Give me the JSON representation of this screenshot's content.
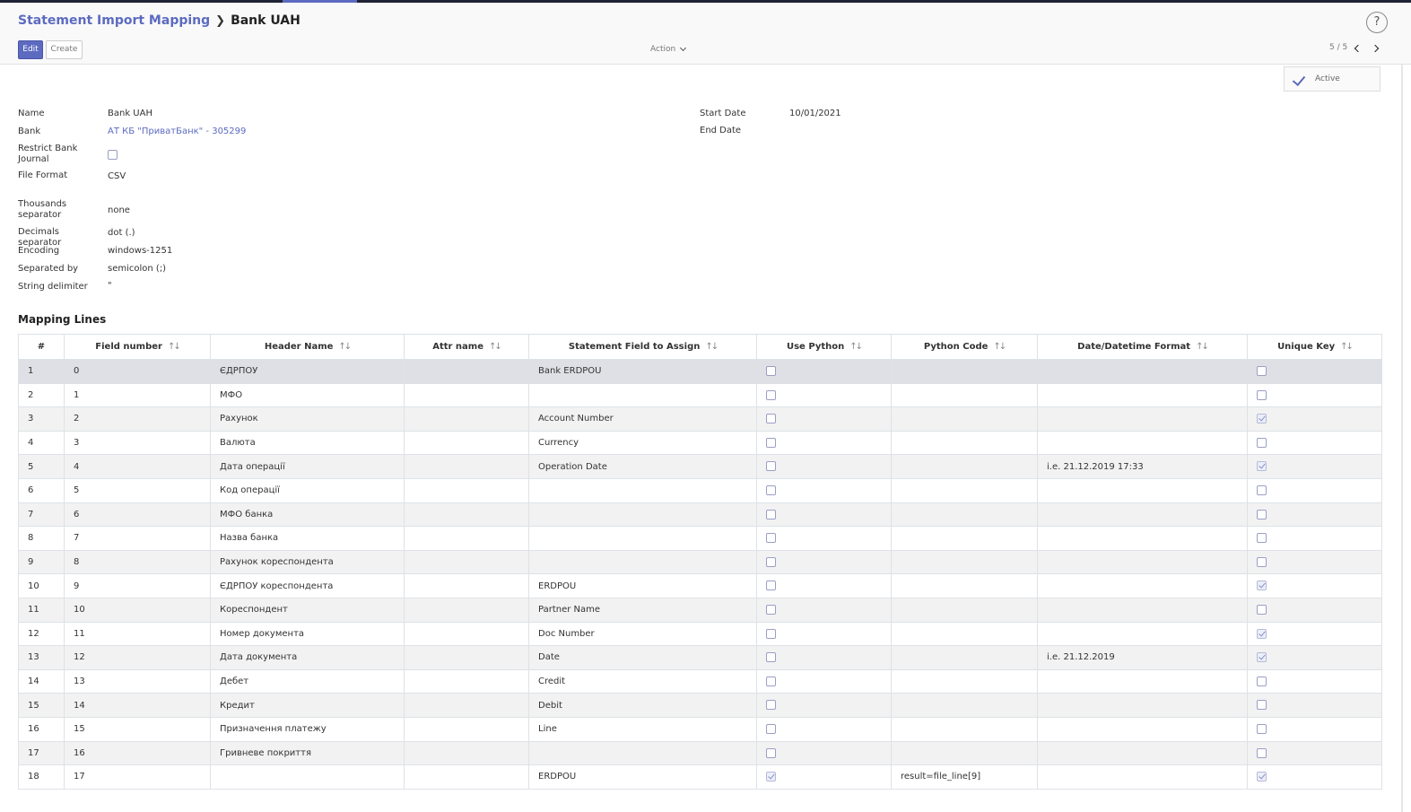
{
  "breadcrumb": {
    "parent": "Statement Import Mapping",
    "current": "Bank UAH"
  },
  "toolbar": {
    "edit_label": "Edit",
    "create_label": "Create",
    "action_label": "Action",
    "pager": "5 / 5",
    "help": "?"
  },
  "status": {
    "active_label": "Active"
  },
  "form": {
    "name_label": "Name",
    "name": "Bank UAH",
    "bank_label": "Bank",
    "bank": "АТ КБ \"ПриватБанк\" - 305299",
    "restrict_label": "Restrict Bank Journal",
    "restrict_checked": false,
    "file_format_label": "File Format",
    "file_format": "CSV",
    "thousands_label": "Thousands separator",
    "thousands": "none",
    "decimals_label": "Decimals separator",
    "decimals": "dot (.)",
    "encoding_label": "Encoding",
    "encoding": "windows-1251",
    "separated_label": "Separated by",
    "separated": "semicolon (;)",
    "delimiter_label": "String delimiter",
    "delimiter": "\"",
    "start_date_label": "Start Date",
    "start_date": "10/01/2021",
    "end_date_label": "End Date",
    "end_date": ""
  },
  "mapping": {
    "title": "Mapping Lines",
    "columns": [
      "#",
      "Field number",
      "Header Name",
      "Attr name",
      "Statement Field to Assign",
      "Use Python",
      "Python Code",
      "Date/Datetime Format",
      "Unique Key"
    ],
    "sortable": [
      false,
      true,
      true,
      true,
      true,
      true,
      true,
      true,
      true
    ],
    "rows": [
      {
        "n": "1",
        "field": "0",
        "header": "ЄДРПОУ",
        "attr": "",
        "assign": "Bank ERDPOU",
        "python": false,
        "code": "",
        "fmt": "",
        "unique": false
      },
      {
        "n": "2",
        "field": "1",
        "header": "МФО",
        "attr": "",
        "assign": "",
        "python": false,
        "code": "",
        "fmt": "",
        "unique": false
      },
      {
        "n": "3",
        "field": "2",
        "header": "Рахунок",
        "attr": "",
        "assign": "Account Number",
        "python": false,
        "code": "",
        "fmt": "",
        "unique": true
      },
      {
        "n": "4",
        "field": "3",
        "header": "Валюта",
        "attr": "",
        "assign": "Currency",
        "python": false,
        "code": "",
        "fmt": "",
        "unique": false
      },
      {
        "n": "5",
        "field": "4",
        "header": "Дата операції",
        "attr": "",
        "assign": "Operation Date",
        "python": false,
        "code": "",
        "fmt": "i.e. 21.12.2019 17:33",
        "unique": true
      },
      {
        "n": "6",
        "field": "5",
        "header": "Код операції",
        "attr": "",
        "assign": "",
        "python": false,
        "code": "",
        "fmt": "",
        "unique": false
      },
      {
        "n": "7",
        "field": "6",
        "header": "МФО банка",
        "attr": "",
        "assign": "",
        "python": false,
        "code": "",
        "fmt": "",
        "unique": false
      },
      {
        "n": "8",
        "field": "7",
        "header": "Назва банка",
        "attr": "",
        "assign": "",
        "python": false,
        "code": "",
        "fmt": "",
        "unique": false
      },
      {
        "n": "9",
        "field": "8",
        "header": "Рахунок кореспондента",
        "attr": "",
        "assign": "",
        "python": false,
        "code": "",
        "fmt": "",
        "unique": false
      },
      {
        "n": "10",
        "field": "9",
        "header": "ЄДРПОУ кореспондента",
        "attr": "",
        "assign": "ERDPOU",
        "python": false,
        "code": "",
        "fmt": "",
        "unique": true
      },
      {
        "n": "11",
        "field": "10",
        "header": "Кореспондент",
        "attr": "",
        "assign": "Partner Name",
        "python": false,
        "code": "",
        "fmt": "",
        "unique": false
      },
      {
        "n": "12",
        "field": "11",
        "header": "Номер документа",
        "attr": "",
        "assign": "Doc Number",
        "python": false,
        "code": "",
        "fmt": "",
        "unique": true
      },
      {
        "n": "13",
        "field": "12",
        "header": "Дата документа",
        "attr": "",
        "assign": "Date",
        "python": false,
        "code": "",
        "fmt": "i.e. 21.12.2019",
        "unique": true
      },
      {
        "n": "14",
        "field": "13",
        "header": "Дебет",
        "attr": "",
        "assign": "Credit",
        "python": false,
        "code": "",
        "fmt": "",
        "unique": false
      },
      {
        "n": "15",
        "field": "14",
        "header": "Кредит",
        "attr": "",
        "assign": "Debit",
        "python": false,
        "code": "",
        "fmt": "",
        "unique": false
      },
      {
        "n": "16",
        "field": "15",
        "header": "Призначення платежу",
        "attr": "",
        "assign": "Line",
        "python": false,
        "code": "",
        "fmt": "",
        "unique": false
      },
      {
        "n": "17",
        "field": "16",
        "header": "Гривневе покриття",
        "attr": "",
        "assign": "",
        "python": false,
        "code": "",
        "fmt": "",
        "unique": false
      },
      {
        "n": "18",
        "field": "17",
        "header": "",
        "attr": "",
        "assign": "ERDPOU",
        "python": true,
        "code": "result=file_line[9]",
        "fmt": "",
        "unique": true
      }
    ]
  },
  "colors": {
    "accent": "#5c6bc0",
    "topbar": "#1f2333"
  }
}
